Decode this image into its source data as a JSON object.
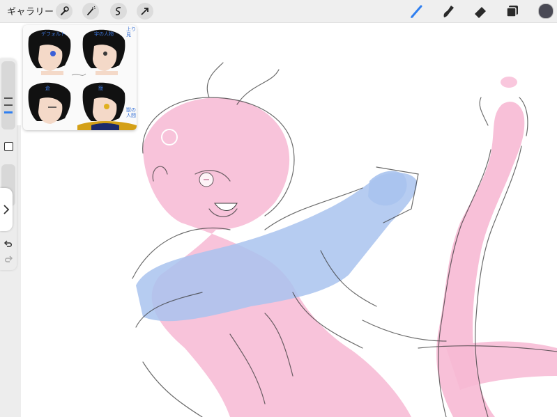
{
  "topbar": {
    "gallery_label": "ギャラリー",
    "left_tools": [
      "wrench-icon",
      "magic-wand-icon",
      "selection-icon",
      "transform-arrow-icon"
    ],
    "right_tools": [
      "brush-icon",
      "smudge-icon",
      "eraser-icon",
      "layers-icon",
      "color-icon"
    ],
    "active_tool": "brush-icon",
    "accent_color": "#2f7ff0",
    "current_color": "#4a4a55"
  },
  "reference": {
    "labels": [
      "デフォルト",
      "宇の人物",
      "上り見",
      "倉",
      "簡",
      "獣の人間"
    ],
    "eye_colors": [
      "#3a5fd8",
      "#3a3a3a",
      "#3a3a3a",
      "#e0b020"
    ]
  },
  "canvas": {
    "tint_pink": "#f7b9d4",
    "tint_blue": "#a9c3ee",
    "line_color": "#3a3a3a"
  }
}
